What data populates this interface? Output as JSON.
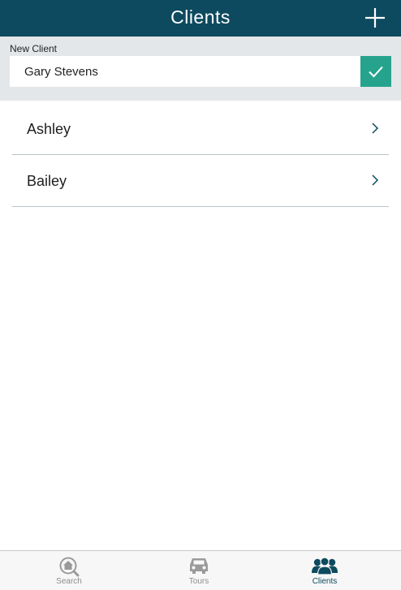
{
  "nav": {
    "title": "Clients",
    "add_icon": "plus-icon"
  },
  "new_client": {
    "label": "New Client",
    "value": "Gary Stevens",
    "confirm_icon": "checkmark-icon"
  },
  "clients": [
    {
      "name": "Ashley"
    },
    {
      "name": "Bailey"
    }
  ],
  "tabs": [
    {
      "label": "Search",
      "icon": "home-search-icon",
      "active": false
    },
    {
      "label": "Tours",
      "icon": "car-icon",
      "active": false
    },
    {
      "label": "Clients",
      "icon": "people-icon",
      "active": true
    }
  ],
  "colors": {
    "nav_background": "#0d4a5f",
    "confirm_button": "#26a38c",
    "panel_background": "#e3e7e9",
    "active_tab": "#0d4a5f",
    "inactive_tab": "#8e8e8e"
  }
}
